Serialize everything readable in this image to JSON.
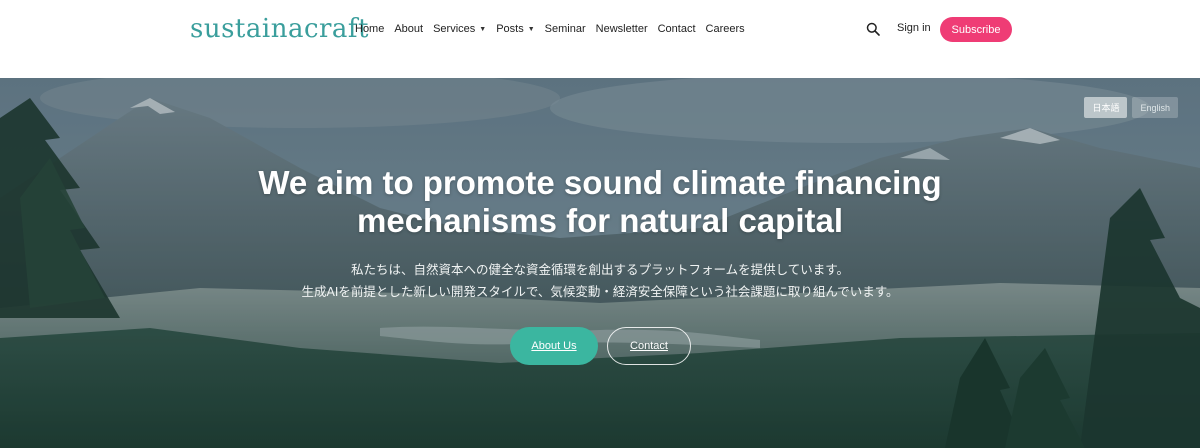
{
  "header": {
    "logo": "sustainacraft",
    "nav": [
      {
        "label": "Home",
        "dropdown": false
      },
      {
        "label": "About",
        "dropdown": false
      },
      {
        "label": "Services",
        "dropdown": true
      },
      {
        "label": "Posts",
        "dropdown": true
      },
      {
        "label": "Seminar",
        "dropdown": false
      },
      {
        "label": "Newsletter",
        "dropdown": false
      },
      {
        "label": "Contact",
        "dropdown": false
      },
      {
        "label": "Careers",
        "dropdown": false
      }
    ],
    "search_icon": "search-icon",
    "sign_in": "Sign in",
    "subscribe": "Subscribe"
  },
  "hero": {
    "languages": [
      "日本語",
      "English"
    ],
    "active_language": "日本語",
    "title_line1": "We aim to promote sound climate financing",
    "title_line2": "mechanisms for natural capital",
    "subtitle_line1": "私たちは、自然資本への健全な資金循環を創出するプラットフォームを提供しています。",
    "subtitle_line2": "生成AIを前提とした新しい開発スタイルで、気候変動・経済安全保障という社会課題に取り組んでいます。",
    "about_button": "About Us",
    "contact_button": "Contact"
  },
  "colors": {
    "brand": "#3a9e9c",
    "subscribe": "#ef3c75",
    "primary_button": "#3bb6a0"
  }
}
